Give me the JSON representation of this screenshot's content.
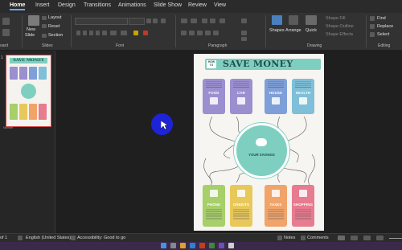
{
  "tabs": [
    "Home",
    "Insert",
    "Design",
    "Transitions",
    "Animations",
    "Slide Show",
    "Review",
    "View"
  ],
  "ribbon": {
    "groups": {
      "clipboard": "oard",
      "slides": "Slides",
      "font": "Font",
      "paragraph": "Paragraph",
      "drawing": "Drawing",
      "editing": "Editing"
    },
    "slides": {
      "new_slide": "New",
      "new_slide_2": "Slide",
      "layout": "Layout",
      "reset": "Reset",
      "section": "Section"
    },
    "drawing": {
      "shapes": "Shapes",
      "arrange": "Arrange",
      "quick_styles": "Quick",
      "shape_fill": "Shape Fill",
      "shape_outline": "Shape Outline",
      "shape_effects": "Shape Effects"
    },
    "editing": {
      "find": "Find",
      "replace": "Replace",
      "select": "Select"
    }
  },
  "thumbnail": {
    "number": "1",
    "title": "SAVE MONEY",
    "footer": "Number"
  },
  "slide": {
    "howto": "HOW TO",
    "title": "SAVE MONEY",
    "top_cards": [
      {
        "label": "FOOD",
        "color": "#9b8fd0",
        "icon": "cart-icon"
      },
      {
        "label": "CAR",
        "color": "#9b8fd0",
        "icon": "car-icon"
      },
      {
        "label": "HOUSE",
        "color": "#7f9fd8",
        "icon": "house-icon"
      },
      {
        "label": "HEALTH",
        "color": "#7fbfd8",
        "icon": "heart-icon"
      }
    ],
    "center_label": "YOUR SAVINGS",
    "bottom_cards": [
      {
        "label": "PHONE",
        "color": "#a7cf6a",
        "icon": "phone-icon"
      },
      {
        "label": "CREDITS",
        "color": "#e8c85a",
        "icon": "card-icon"
      },
      {
        "label": "TAXES",
        "color": "#f0a46a",
        "icon": "document-icon"
      },
      {
        "label": "SHOPPING",
        "color": "#e77b8f",
        "icon": "bag-icon"
      }
    ]
  },
  "status": {
    "slide_of": "of 1",
    "language": "English (United States)",
    "accessibility": "Accessibility: Good to go",
    "notes": "Notes",
    "comments": "Comments"
  }
}
